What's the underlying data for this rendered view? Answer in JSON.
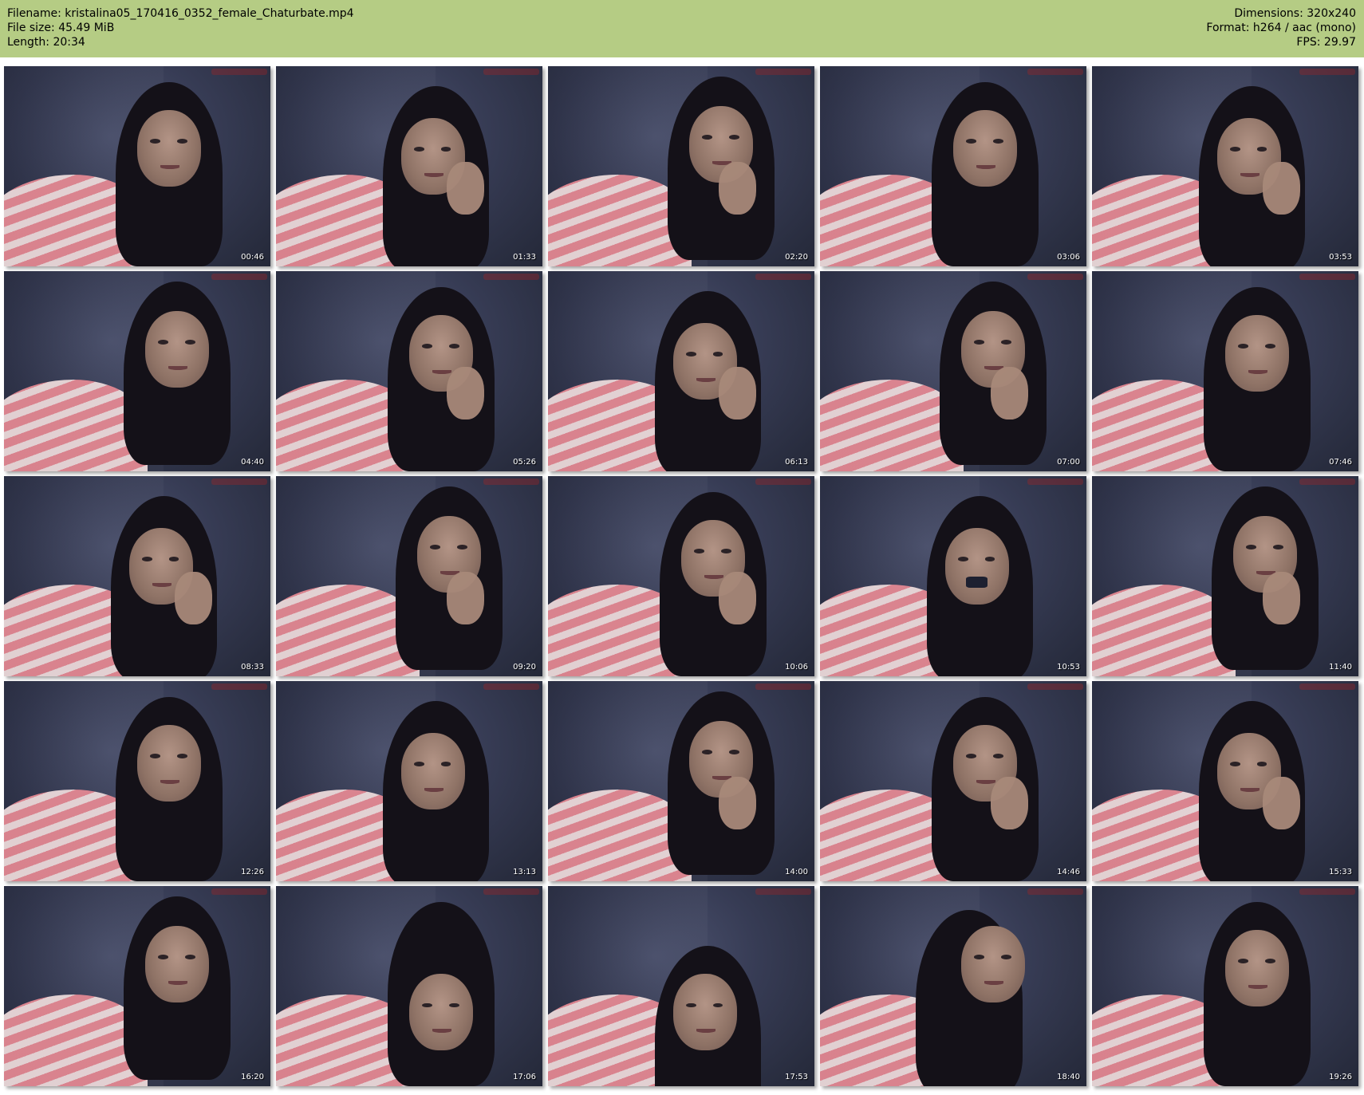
{
  "header": {
    "filename_label": "Filename: kristalina05_170416_0352_female_Chaturbate.mp4",
    "filesize_label": "File size: 45.49 MiB",
    "length_label": "Length: 20:34",
    "dimensions_label": "Dimensions: 320x240",
    "format_label": "Format: h264 / aac (mono)",
    "fps_label": "FPS: 29.97"
  },
  "colors": {
    "header_background": "#b5cc84",
    "page_background": "#ffffff",
    "timestamp_text": "#ffffff"
  },
  "thumbnails": [
    {
      "time": "00:46"
    },
    {
      "time": "01:33"
    },
    {
      "time": "02:20"
    },
    {
      "time": "03:06"
    },
    {
      "time": "03:53"
    },
    {
      "time": "04:40"
    },
    {
      "time": "05:26"
    },
    {
      "time": "06:13"
    },
    {
      "time": "07:00"
    },
    {
      "time": "07:46"
    },
    {
      "time": "08:33"
    },
    {
      "time": "09:20"
    },
    {
      "time": "10:06"
    },
    {
      "time": "10:53"
    },
    {
      "time": "11:40"
    },
    {
      "time": "12:26"
    },
    {
      "time": "13:13"
    },
    {
      "time": "14:00"
    },
    {
      "time": "14:46"
    },
    {
      "time": "15:33"
    },
    {
      "time": "16:20"
    },
    {
      "time": "17:06"
    },
    {
      "time": "17:53"
    },
    {
      "time": "18:40"
    },
    {
      "time": "19:26"
    }
  ]
}
